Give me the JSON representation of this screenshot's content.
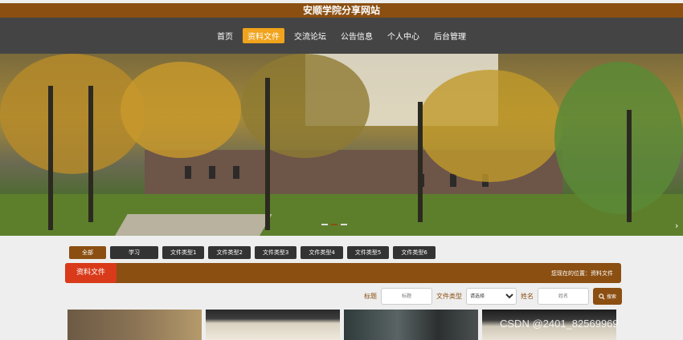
{
  "site": {
    "title": "安顺学院分享网站"
  },
  "nav": {
    "items": [
      {
        "label": "首页"
      },
      {
        "label": "资料文件",
        "active": true
      },
      {
        "label": "交流论坛"
      },
      {
        "label": "公告信息"
      },
      {
        "label": "个人中心"
      },
      {
        "label": "后台管理"
      }
    ]
  },
  "filters": [
    "全部",
    "学习",
    "文件类型1",
    "文件类型2",
    "文件类型3",
    "文件类型4",
    "文件类型5",
    "文件类型6"
  ],
  "section": {
    "title": "资料文件",
    "breadcrumb": "您现在的位置：资料文件"
  },
  "search": {
    "title_label": "标题",
    "title_placeholder": "标题",
    "type_label": "文件类型",
    "type_selected": "请选择",
    "name_label": "姓名",
    "name_placeholder": "姓名",
    "button_label": "搜索"
  },
  "watermark": "CSDN @2401_82569969",
  "colors": {
    "brand": "#8b4f12",
    "accent": "#f0a31c",
    "nav_bg": "#444444"
  }
}
